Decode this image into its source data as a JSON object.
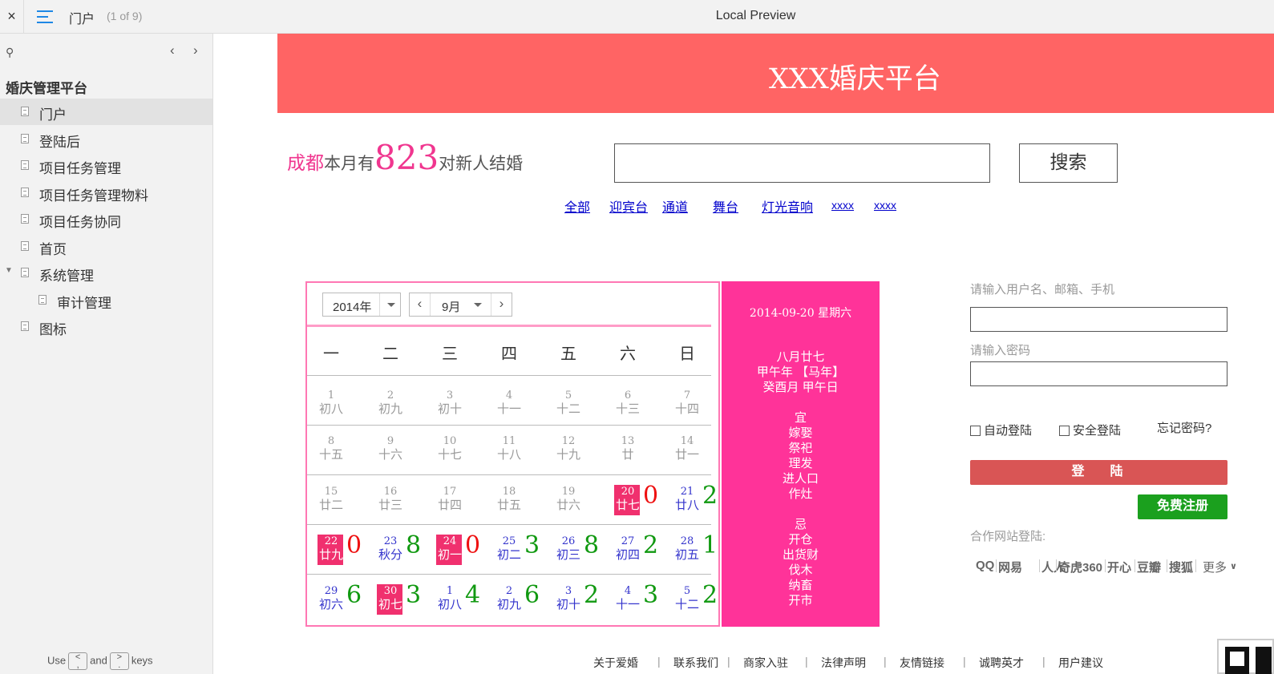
{
  "topbar": {
    "close": "×",
    "page": "门户",
    "count": "(1 of 9)",
    "title": "Local Preview"
  },
  "sidebar": {
    "root": "婚庆管理平台",
    "items": [
      {
        "label": "门户",
        "selected": true
      },
      {
        "label": "登陆后"
      },
      {
        "label": "项目任务管理"
      },
      {
        "label": "项目任务管理物料"
      },
      {
        "label": "项目任务协同"
      },
      {
        "label": "首页"
      },
      {
        "label": "系统管理",
        "expanded": true
      },
      {
        "label": "审计管理",
        "child": true
      },
      {
        "label": "图标"
      }
    ],
    "hint": {
      "use": "Use",
      "and": "and",
      "keys": "keys",
      "key1": "<\n,",
      "key2": ">\n."
    }
  },
  "banner": {
    "title": "XXX婚庆平台",
    "color": "#ff6464"
  },
  "stat": {
    "city": "成都",
    "prefix": "本月有",
    "number": "823",
    "suffix": "对新人结婚"
  },
  "search": {
    "value": "",
    "button": "搜索"
  },
  "categories": [
    "全部",
    "迎宾台",
    "通道",
    "舞台",
    "灯光音响",
    "xxxx",
    "xxxx"
  ],
  "calendar": {
    "year": "2014年",
    "month": "9月",
    "weekdays": [
      "一",
      "二",
      "三",
      "四",
      "五",
      "六",
      "日"
    ],
    "rows": [
      [
        {
          "d": "1",
          "l": "初八",
          "s": "gray"
        },
        {
          "d": "2",
          "l": "初九",
          "s": "gray"
        },
        {
          "d": "3",
          "l": "初十",
          "s": "gray"
        },
        {
          "d": "4",
          "l": "十一",
          "s": "gray"
        },
        {
          "d": "5",
          "l": "十二",
          "s": "gray"
        },
        {
          "d": "6",
          "l": "十三",
          "s": "gray"
        },
        {
          "d": "7",
          "l": "十四",
          "s": "gray"
        }
      ],
      [
        {
          "d": "8",
          "l": "十五",
          "s": "gray"
        },
        {
          "d": "9",
          "l": "十六",
          "s": "gray"
        },
        {
          "d": "10",
          "l": "十七",
          "s": "gray"
        },
        {
          "d": "11",
          "l": "十八",
          "s": "gray"
        },
        {
          "d": "12",
          "l": "十九",
          "s": "gray"
        },
        {
          "d": "13",
          "l": "廿",
          "s": "gray"
        },
        {
          "d": "14",
          "l": "廿一",
          "s": "gray"
        }
      ],
      [
        {
          "d": "15",
          "l": "廿二",
          "s": "gray"
        },
        {
          "d": "16",
          "l": "廿三",
          "s": "gray"
        },
        {
          "d": "17",
          "l": "廿四",
          "s": "gray"
        },
        {
          "d": "18",
          "l": "廿五",
          "s": "gray"
        },
        {
          "d": "19",
          "l": "廿六",
          "s": "gray"
        },
        {
          "d": "20",
          "l": "廿七",
          "s": "hl",
          "c": "0"
        },
        {
          "d": "21",
          "l": "廿八",
          "s": "blue",
          "c": "2"
        }
      ],
      [
        {
          "d": "22",
          "l": "廿九",
          "s": "hl",
          "c": "0"
        },
        {
          "d": "23",
          "l": "秋分",
          "s": "blue",
          "c": "8"
        },
        {
          "d": "24",
          "l": "初一",
          "s": "hl",
          "c": "0"
        },
        {
          "d": "25",
          "l": "初二",
          "s": "blue",
          "c": "3"
        },
        {
          "d": "26",
          "l": "初三",
          "s": "blue",
          "c": "8"
        },
        {
          "d": "27",
          "l": "初四",
          "s": "blue",
          "c": "2"
        },
        {
          "d": "28",
          "l": "初五",
          "s": "blue",
          "c": "1"
        }
      ],
      [
        {
          "d": "29",
          "l": "初六",
          "s": "blue",
          "c": "6"
        },
        {
          "d": "30",
          "l": "初七",
          "s": "hl",
          "c": "3"
        },
        {
          "d": "1",
          "l": "初八",
          "s": "blue",
          "c": "4"
        },
        {
          "d": "2",
          "l": "初九",
          "s": "blue",
          "c": "6"
        },
        {
          "d": "3",
          "l": "初十",
          "s": "blue",
          "c": "2"
        },
        {
          "d": "4",
          "l": "十一",
          "s": "blue",
          "c": "3"
        },
        {
          "d": "5",
          "l": "十二",
          "s": "blue",
          "c": "2"
        }
      ]
    ],
    "colors": {
      "zero": "#ee1111",
      "nonzero": "#119911",
      "highlight": "#f0306e",
      "border": "#ff77b4"
    }
  },
  "info": {
    "date": "2014-09-20 星期六",
    "lunar": [
      "八月廿七",
      "甲午年 【马年】",
      "癸酉月 甲午日"
    ],
    "yi_title": "宜",
    "yi": [
      "嫁娶",
      "祭祀",
      "理发",
      "进人口",
      "作灶"
    ],
    "ji_title": "忌",
    "ji": [
      "开仓",
      "出货财",
      "伐木",
      "纳畜",
      "开市"
    ],
    "color": "#ff3399"
  },
  "login": {
    "username_label": "请输入用户名、邮箱、手机",
    "username_value": "",
    "password_label": "请输入密码",
    "password_value": "",
    "auto_login": "自动登陆",
    "secure_login": "安全登陆",
    "forgot": "忘记密码?",
    "login_button": "登陆",
    "register_button": "免费注册",
    "partner_title": "合作网站登陆:",
    "partners": [
      "QQ",
      "网易",
      "人人",
      "奇虎360",
      "开心",
      "豆瓣",
      "搜狐"
    ],
    "more": "更多"
  },
  "footer": [
    "关于爱婚",
    "联系我们",
    "商家入驻",
    "法律声明",
    "友情链接",
    "诚聘英才",
    "用户建议"
  ]
}
